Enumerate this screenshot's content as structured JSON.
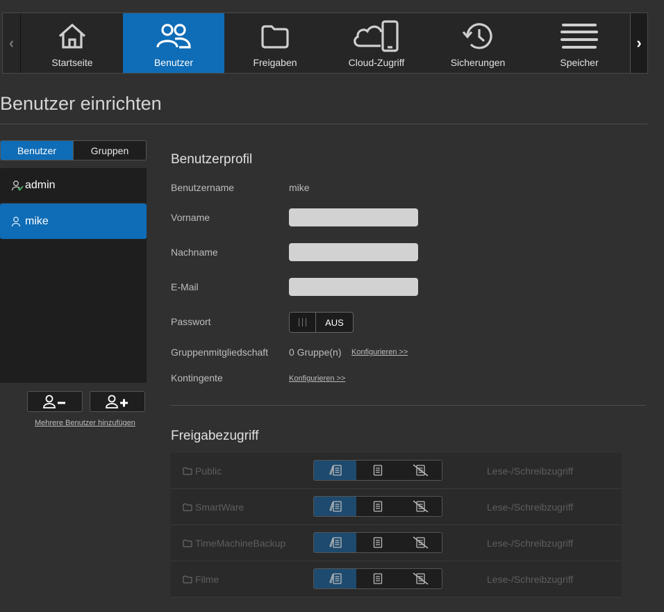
{
  "nav": {
    "items": [
      {
        "label": "Startseite",
        "icon": "home-icon"
      },
      {
        "label": "Benutzer",
        "icon": "users-icon",
        "active": true
      },
      {
        "label": "Freigaben",
        "icon": "folder-icon"
      },
      {
        "label": "Cloud-Zugriff",
        "icon": "cloud-device-icon"
      },
      {
        "label": "Sicherungen",
        "icon": "history-icon"
      },
      {
        "label": "Speicher",
        "icon": "storage-icon"
      }
    ],
    "prev_glyph": "‹",
    "next_glyph": "›"
  },
  "page": {
    "title": "Benutzer einrichten"
  },
  "tabs": {
    "users": "Benutzer",
    "groups": "Gruppen"
  },
  "users": [
    {
      "name": "admin",
      "icon": "admin-user-icon"
    },
    {
      "name": "mike",
      "icon": "user-icon",
      "active": true
    }
  ],
  "actions": {
    "multi_add": "Mehrere Benutzer hinzufügen"
  },
  "profile": {
    "title": "Benutzerprofil",
    "username_label": "Benutzername",
    "username_value": "mike",
    "firstname_label": "Vorname",
    "firstname_value": "",
    "lastname_label": "Nachname",
    "lastname_value": "",
    "email_label": "E-Mail",
    "email_value": "",
    "password_label": "Passwort",
    "password_toggle": "AUS",
    "groups_label": "Gruppenmitgliedschaft",
    "groups_value": "0 Gruppe(n)",
    "configure_link": "Konfigurieren >>",
    "quota_label": "Kontingente",
    "quota_link": "Konfigurieren >>"
  },
  "share_access": {
    "title": "Freigabezugriff",
    "rows": [
      {
        "name": "Public",
        "access": "Lese-/Schreibzugriff"
      },
      {
        "name": "SmartWare",
        "access": "Lese-/Schreibzugriff"
      },
      {
        "name": "TimeMachineBackup",
        "access": "Lese-/Schreibzugriff"
      },
      {
        "name": "Filme",
        "access": "Lese-/Schreibzugriff"
      }
    ]
  },
  "colors": {
    "accent": "#0f6cb6",
    "background": "#303030",
    "panel": "#1e1e1e"
  }
}
